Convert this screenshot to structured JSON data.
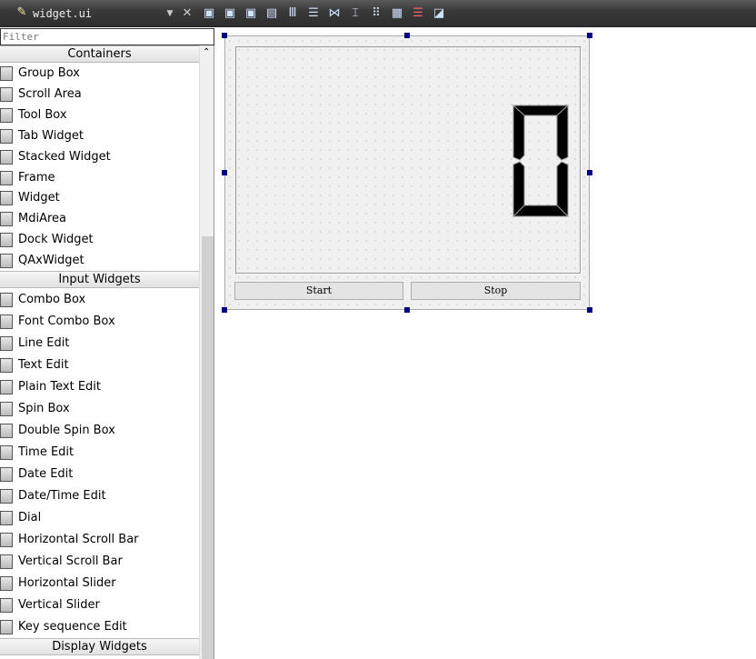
{
  "toolbar": {
    "filename": "widget.ui"
  },
  "filter": {
    "placeholder": "Filter"
  },
  "sidebar": {
    "partial_category": "Containers",
    "containers": [
      "Group Box",
      "Scroll Area",
      "Tool Box",
      "Tab Widget",
      "Stacked Widget",
      "Frame",
      "Widget",
      "MdiArea",
      "Dock Widget",
      "QAxWidget"
    ],
    "input_category": "Input Widgets",
    "inputs": [
      "Combo Box",
      "Font Combo Box",
      "Line Edit",
      "Text Edit",
      "Plain Text Edit",
      "Spin Box",
      "Double Spin Box",
      "Time Edit",
      "Date Edit",
      "Date/Time Edit",
      "Dial",
      "Horizontal Scroll Bar",
      "Vertical Scroll Bar",
      "Horizontal Slider",
      "Vertical Slider",
      "Key sequence Edit"
    ],
    "display_category": "Display Widgets"
  },
  "form": {
    "lcd_value": "0",
    "start_label": "Start",
    "stop_label": "Stop"
  }
}
